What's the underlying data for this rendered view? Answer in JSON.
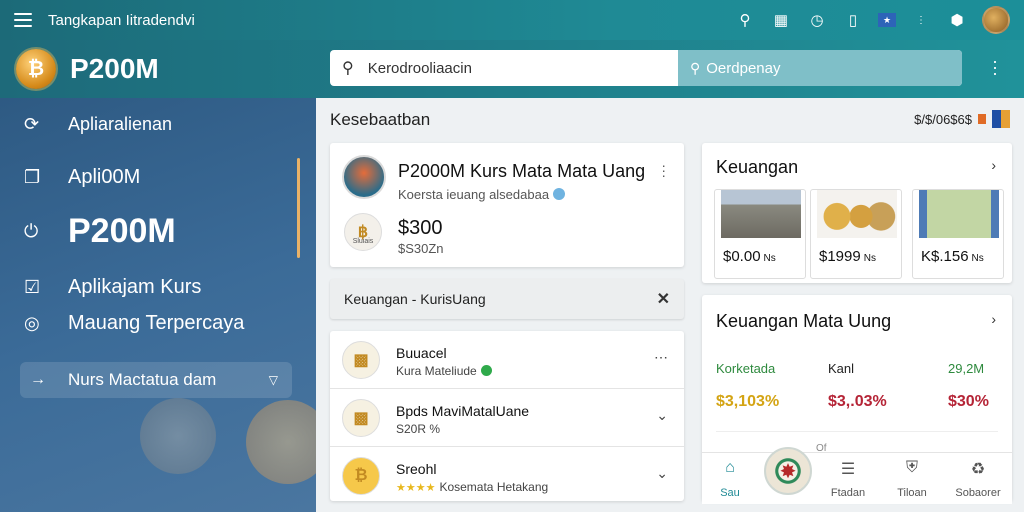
{
  "topbar": {
    "title": "Tangkapan Iitradendvi",
    "icons": [
      "search-icon",
      "gallery-icon",
      "timer-icon",
      "chart-icon",
      "flag-icon",
      "more-icon",
      "shield-icon"
    ]
  },
  "header": {
    "brand": "P200M",
    "search_placeholder": "Kerodrooliaacin",
    "search_secondary": "Oerdpenay"
  },
  "sidebar": {
    "items": [
      {
        "label": "Apliaralienan",
        "icon": "refresh-icon"
      },
      {
        "label": "Apli00M",
        "icon": "copy-icon"
      },
      {
        "label": "P200M",
        "icon": "power-icon"
      },
      {
        "label": "Aplikajam Kurs",
        "icon": "check-icon"
      },
      {
        "label": "Mauang Terpercaya",
        "icon": "circle-icon"
      }
    ],
    "active": {
      "label": "Nurs Mactatua dam",
      "icon": "arrow-icon"
    }
  },
  "main": {
    "heading": "Kesebaatban",
    "meta": "$/$/06$6$",
    "featured": {
      "title": "P2000M Kurs Mata Mata Uang",
      "subtitle": "Koersta ieuang alsedabaa",
      "price": "$300",
      "price_sub": "$S30Zn",
      "coin_label": "Sluiais"
    },
    "filter": {
      "label": "Keuangan - KurisUang"
    },
    "list": [
      {
        "title": "Buuacel",
        "subtitle": "Kura Mateliude",
        "badge": "check",
        "action": "more"
      },
      {
        "title": "Bpds MaviMatalUane",
        "subtitle": "S20R %",
        "badge": "",
        "action": "chevron"
      },
      {
        "title": "Sreohl",
        "subtitle": "Kosemata Hetakang",
        "badge": "stars",
        "action": "chevron"
      }
    ]
  },
  "right_top": {
    "title": "Keuangan",
    "thumbs": [
      {
        "value": "$0.00",
        "unit": "Ns"
      },
      {
        "value": "$1999",
        "unit": "Ns"
      },
      {
        "value": "K$.156",
        "unit": "Ns"
      }
    ]
  },
  "right_mid": {
    "title": "Keuangan Mata Uung",
    "cols": [
      {
        "label": "Korketada",
        "value": "$3,103%",
        "label_color": "#2e8a3e",
        "value_color": "#d4a414"
      },
      {
        "label": "Kanl",
        "value": "$3,.03%",
        "label_color": "#222",
        "value_color": "#b52436"
      },
      {
        "label": "29,2M",
        "value": "$30%",
        "label_color": "#2e8a3e",
        "value_color": "#b52436"
      }
    ],
    "tiny": "Of"
  },
  "bottom_nav": [
    {
      "label": "Sau",
      "icon": "home-icon",
      "active": true
    },
    {
      "label": "Ftadan",
      "icon": "list-icon",
      "active": false
    },
    {
      "label": "Tiloan",
      "icon": "shield-icon",
      "active": false
    },
    {
      "label": "Sobaorer",
      "icon": "recycle-icon",
      "active": false
    }
  ]
}
